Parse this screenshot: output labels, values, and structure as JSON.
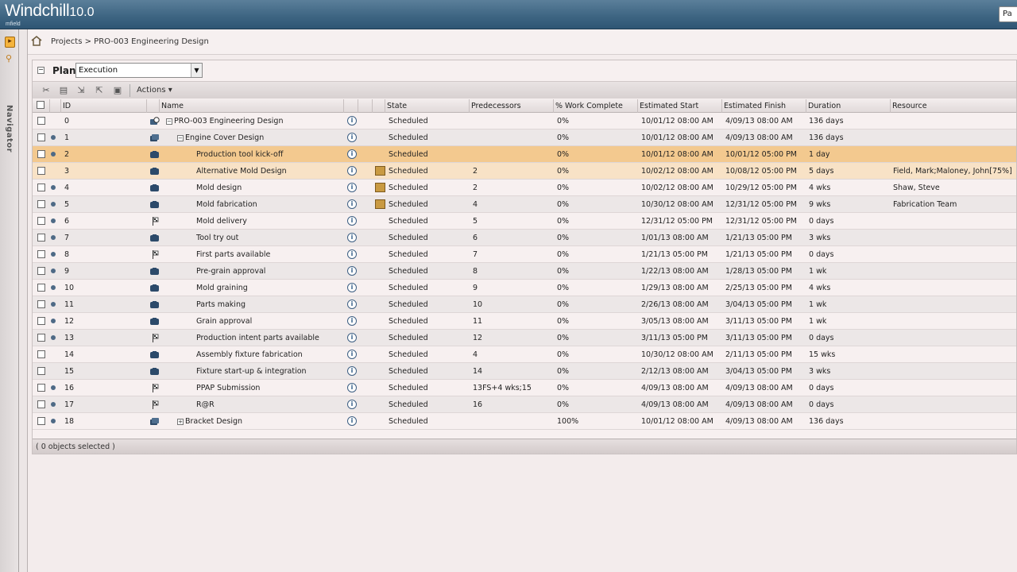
{
  "app": {
    "name": "Windchill",
    "version": "10.0",
    "subtext": "mfield",
    "top_right_button": "Pa"
  },
  "navigator": {
    "label": "Navigator"
  },
  "breadcrumb": {
    "text": "Projects > PRO-003 Engineering Design"
  },
  "plan": {
    "label": "Plan",
    "view": "Execution"
  },
  "toolbar": {
    "actions_label": "Actions ▾"
  },
  "table": {
    "headers": {
      "id": "ID",
      "name": "Name",
      "state": "State",
      "predecessors": "Predecessors",
      "work": "% Work Complete",
      "start": "Estimated Start",
      "finish": "Estimated Finish",
      "duration": "Duration",
      "resource": "Resource"
    },
    "rows": [
      {
        "id": "0",
        "name": "PRO-003 Engineering Design",
        "state": "Scheduled",
        "pred": "",
        "work": "0%",
        "start": "10/01/12 08:00 AM",
        "finish": "4/09/13 08:00 AM",
        "duration": "136 days",
        "resource": ""
      },
      {
        "id": "1",
        "name": "Engine Cover Design",
        "state": "Scheduled",
        "pred": "",
        "work": "0%",
        "start": "10/01/12 08:00 AM",
        "finish": "4/09/13 08:00 AM",
        "duration": "136 days",
        "resource": ""
      },
      {
        "id": "2",
        "name": "Production tool kick-off",
        "state": "Scheduled",
        "pred": "",
        "work": "0%",
        "start": "10/01/12 08:00 AM",
        "finish": "10/01/12 05:00 PM",
        "duration": "1 day",
        "resource": ""
      },
      {
        "id": "3",
        "name": "Alternative Mold Design",
        "state": "Scheduled",
        "pred": "2",
        "work": "0%",
        "start": "10/02/12 08:00 AM",
        "finish": "10/08/12 05:00 PM",
        "duration": "5 days",
        "resource": "Field, Mark;Maloney, John[75%]"
      },
      {
        "id": "4",
        "name": "Mold design",
        "state": "Scheduled",
        "pred": "2",
        "work": "0%",
        "start": "10/02/12 08:00 AM",
        "finish": "10/29/12 05:00 PM",
        "duration": "4 wks",
        "resource": "Shaw, Steve"
      },
      {
        "id": "5",
        "name": "Mold fabrication",
        "state": "Scheduled",
        "pred": "4",
        "work": "0%",
        "start": "10/30/12 08:00 AM",
        "finish": "12/31/12 05:00 PM",
        "duration": "9 wks",
        "resource": "Fabrication Team"
      },
      {
        "id": "6",
        "name": "Mold delivery",
        "state": "Scheduled",
        "pred": "5",
        "work": "0%",
        "start": "12/31/12 05:00 PM",
        "finish": "12/31/12 05:00 PM",
        "duration": "0 days",
        "resource": ""
      },
      {
        "id": "7",
        "name": "Tool try out",
        "state": "Scheduled",
        "pred": "6",
        "work": "0%",
        "start": "1/01/13 08:00 AM",
        "finish": "1/21/13 05:00 PM",
        "duration": "3 wks",
        "resource": ""
      },
      {
        "id": "8",
        "name": "First parts available",
        "state": "Scheduled",
        "pred": "7",
        "work": "0%",
        "start": "1/21/13 05:00 PM",
        "finish": "1/21/13 05:00 PM",
        "duration": "0 days",
        "resource": ""
      },
      {
        "id": "9",
        "name": "Pre-grain approval",
        "state": "Scheduled",
        "pred": "8",
        "work": "0%",
        "start": "1/22/13 08:00 AM",
        "finish": "1/28/13 05:00 PM",
        "duration": "1 wk",
        "resource": ""
      },
      {
        "id": "10",
        "name": "Mold graining",
        "state": "Scheduled",
        "pred": "9",
        "work": "0%",
        "start": "1/29/13 08:00 AM",
        "finish": "2/25/13 05:00 PM",
        "duration": "4 wks",
        "resource": ""
      },
      {
        "id": "11",
        "name": "Parts making",
        "state": "Scheduled",
        "pred": "10",
        "work": "0%",
        "start": "2/26/13 08:00 AM",
        "finish": "3/04/13 05:00 PM",
        "duration": "1 wk",
        "resource": ""
      },
      {
        "id": "12",
        "name": "Grain approval",
        "state": "Scheduled",
        "pred": "11",
        "work": "0%",
        "start": "3/05/13 08:00 AM",
        "finish": "3/11/13 05:00 PM",
        "duration": "1 wk",
        "resource": ""
      },
      {
        "id": "13",
        "name": "Production intent parts available",
        "state": "Scheduled",
        "pred": "12",
        "work": "0%",
        "start": "3/11/13 05:00 PM",
        "finish": "3/11/13 05:00 PM",
        "duration": "0 days",
        "resource": ""
      },
      {
        "id": "14",
        "name": "Assembly fixture fabrication",
        "state": "Scheduled",
        "pred": "4",
        "work": "0%",
        "start": "10/30/12 08:00 AM",
        "finish": "2/11/13 05:00 PM",
        "duration": "15 wks",
        "resource": ""
      },
      {
        "id": "15",
        "name": "Fixture start-up & integration",
        "state": "Scheduled",
        "pred": "14",
        "work": "0%",
        "start": "2/12/13 08:00 AM",
        "finish": "3/04/13 05:00 PM",
        "duration": "3 wks",
        "resource": ""
      },
      {
        "id": "16",
        "name": "PPAP Submission",
        "state": "Scheduled",
        "pred": "13FS+4 wks;15",
        "work": "0%",
        "start": "4/09/13 08:00 AM",
        "finish": "4/09/13 08:00 AM",
        "duration": "0 days",
        "resource": ""
      },
      {
        "id": "17",
        "name": "R@R",
        "state": "Scheduled",
        "pred": "16",
        "work": "0%",
        "start": "4/09/13 08:00 AM",
        "finish": "4/09/13 08:00 AM",
        "duration": "0 days",
        "resource": ""
      },
      {
        "id": "18",
        "name": "Bracket Design",
        "state": "Scheduled",
        "pred": "",
        "work": "100%",
        "start": "10/01/12 08:00 AM",
        "finish": "4/09/13 08:00 AM",
        "duration": "136 days",
        "resource": ""
      }
    ]
  },
  "footer": {
    "status": "( 0 objects selected )"
  }
}
